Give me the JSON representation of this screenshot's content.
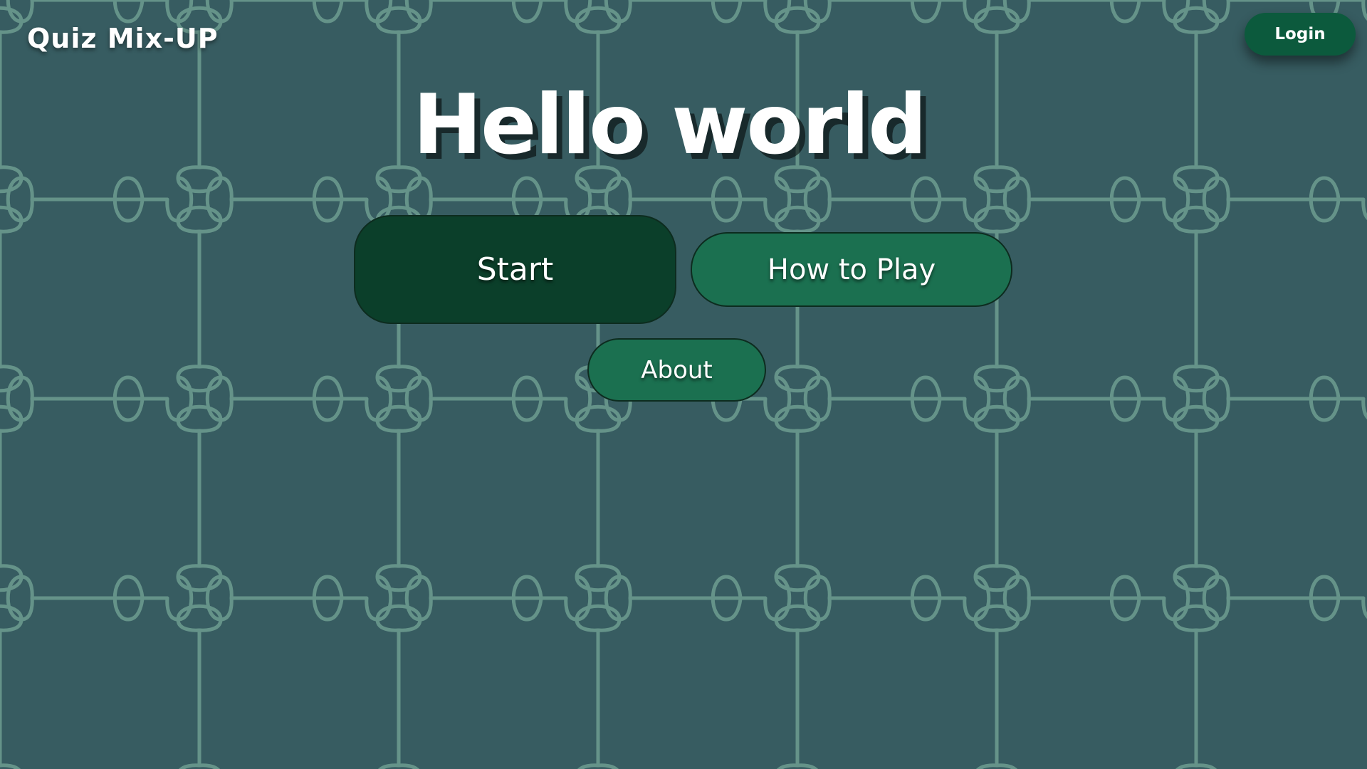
{
  "app": {
    "brand": "Quiz Mix-UP"
  },
  "header": {
    "login_label": "Login"
  },
  "main": {
    "title": "Hello world",
    "buttons": {
      "start_label": "Start",
      "how_to_play_label": "How to Play",
      "about_label": "About"
    }
  },
  "colors": {
    "background": "#375c61",
    "puzzle_lines": "#7fb3a0",
    "start_button": "#0b3f2a",
    "secondary_button": "#1b7050",
    "login_button": "#0c5a3d"
  }
}
